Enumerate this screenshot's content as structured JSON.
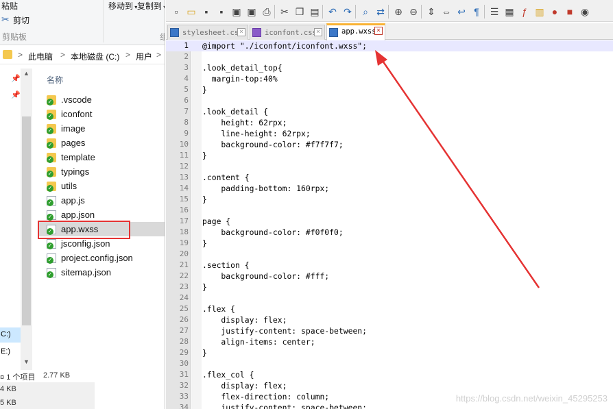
{
  "explorer": {
    "ribbon": {
      "paste_label": "粘贴",
      "cut_label": "剪切",
      "clipboard_group": "剪贴板",
      "move_to_label": "移动到",
      "copy_to_label": "复制到",
      "organize_partial": "组"
    },
    "address": {
      "parts": [
        "此电脑",
        "本地磁盘 (C:)",
        "用户"
      ],
      "separator": ">"
    },
    "column_header": "名称",
    "files": [
      {
        "name": ".vscode",
        "kind": "folder"
      },
      {
        "name": "iconfont",
        "kind": "folder"
      },
      {
        "name": "image",
        "kind": "folder"
      },
      {
        "name": "pages",
        "kind": "folder"
      },
      {
        "name": "template",
        "kind": "folder"
      },
      {
        "name": "typings",
        "kind": "folder"
      },
      {
        "name": "utils",
        "kind": "folder"
      },
      {
        "name": "app.js",
        "kind": "file"
      },
      {
        "name": "app.json",
        "kind": "file"
      },
      {
        "name": "app.wxss",
        "kind": "file",
        "selected": true
      },
      {
        "name": "jsconfig.json",
        "kind": "file"
      },
      {
        "name": "project.config.json",
        "kind": "file"
      },
      {
        "name": "sitemap.json",
        "kind": "file"
      }
    ],
    "drives": {
      "c": "C:)",
      "e": "E:)"
    },
    "status": {
      "item_count": "1 个项目",
      "size": "2.77 KB",
      "size_b": "4 KB",
      "size_c": "5 KB"
    }
  },
  "editor": {
    "tabs": [
      {
        "label": "stylesheet.css",
        "active": false,
        "icon": "blue"
      },
      {
        "label": "iconfont.css",
        "active": false,
        "icon": "purple"
      },
      {
        "label": "app.wxss",
        "active": true,
        "icon": "blue"
      }
    ],
    "toolbar_icons": [
      "new-file-icon",
      "open-file-icon",
      "save-icon",
      "save-all-icon",
      "close-icon",
      "close-all-icon",
      "print-icon",
      "cut-icon",
      "copy-icon",
      "paste-icon",
      "undo-icon",
      "redo-icon",
      "find-icon",
      "replace-icon",
      "zoom-in-icon",
      "zoom-out-icon",
      "sync-v-icon",
      "sync-h-icon",
      "word-wrap-icon",
      "show-all-chars-icon",
      "indent-guide-icon",
      "folder-workspace-icon",
      "function-list-icon",
      "doc-map-icon",
      "record-macro-icon",
      "stop-macro-icon",
      "playback-macro-icon"
    ],
    "current_line": 1,
    "code_lines": [
      "@import \"./iconfont/iconfont.wxss\";",
      "",
      ".look_detail_top{",
      "  margin-top:40%",
      "}",
      "",
      ".look_detail {",
      "    height: 62rpx;",
      "    line-height: 62rpx;",
      "    background-color: #f7f7f7;",
      "}",
      "",
      ".content {",
      "    padding-bottom: 160rpx;",
      "}",
      "",
      "page {",
      "    background-color: #f0f0f0;",
      "}",
      "",
      ".section {",
      "    background-color: #fff;",
      "}",
      "",
      ".flex {",
      "    display: flex;",
      "    justify-content: space-between;",
      "    align-items: center;",
      "}",
      "",
      ".flex_col {",
      "    display: flex;",
      "    flex-direction: column;",
      "    justify-content: space-between;"
    ]
  },
  "watermark": "https://blog.csdn.net/weixin_45295253",
  "colors": {
    "annotation_red": "#e53333",
    "current_line": "#e8e8ff",
    "selection_grey": "#d9d9d9"
  }
}
